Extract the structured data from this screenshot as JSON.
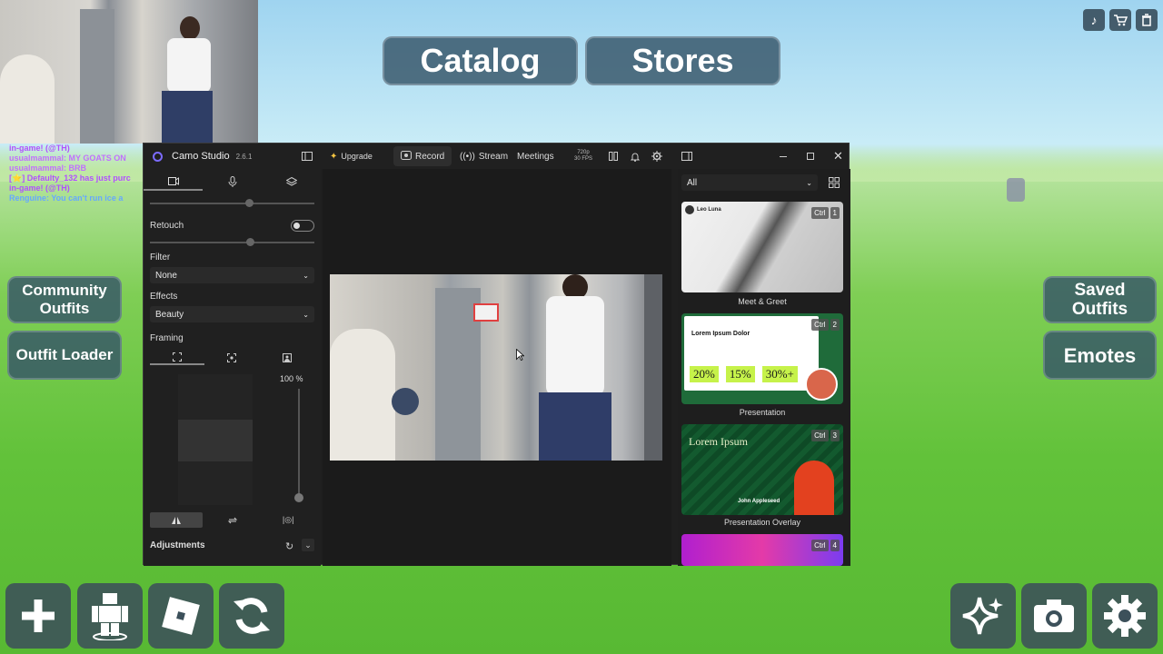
{
  "game": {
    "top_buttons": [
      "Catalog",
      "Stores"
    ],
    "left_buttons": [
      "Community Outfits",
      "Outfit Loader"
    ],
    "right_buttons": [
      "Saved Outfits",
      "Emotes"
    ],
    "bottom_left_icons": [
      "plus-icon",
      "avatar-icon",
      "roblox-logo-icon",
      "refresh-icon"
    ],
    "bottom_right_icons": [
      "sparkle-icon",
      "camera-icon",
      "settings-icon"
    ],
    "top_right_icons": [
      "music-icon",
      "cart-icon",
      "trash-icon"
    ]
  },
  "chat": {
    "lines": [
      {
        "text": "in-game! (@TH)",
        "color": "#b050ff"
      },
      {
        "text": "usualmammal: MY GOATS ON",
        "color": "#c070ff"
      },
      {
        "text": "usualmammal: BRB",
        "color": "#c070ff"
      },
      {
        "text": "[⭐] Defaulty_132 has just purc",
        "color": "#b050ff"
      },
      {
        "text": "in-game! (@TH)",
        "color": "#b050ff"
      },
      {
        "text": "Renguine: You can't run ice a",
        "color": "#66a8ff"
      }
    ]
  },
  "camo": {
    "app_name": "Camo Studio",
    "version": "2.6.1",
    "upgrade": "Upgrade",
    "record": "Record",
    "stream": "Stream",
    "meetings": "Meetings",
    "resolution": "720p",
    "fps": "30 FPS",
    "retouch_label": "Retouch",
    "filter_label": "Filter",
    "filter_value": "None",
    "effects_label": "Effects",
    "effects_value": "Beauty",
    "framing_label": "Framing",
    "zoom_value": "100 %",
    "adjustments_label": "Adjustments",
    "overlay_filter": "All",
    "overlays": [
      {
        "label": "Meet & Greet",
        "ctrl": "Ctrl",
        "key": "1",
        "card_name": "Leo Luna"
      },
      {
        "label": "Presentation",
        "ctrl": "Ctrl",
        "key": "2",
        "card_title": "Lorem Ipsum Dolor",
        "stats": [
          "20%",
          "15%",
          "30%+"
        ]
      },
      {
        "label": "Presentation Overlay",
        "ctrl": "Ctrl",
        "key": "3",
        "card_title": "Lorem Ipsum",
        "card_name": "John Appleseed"
      },
      {
        "label": "",
        "ctrl": "Ctrl",
        "key": "4"
      }
    ]
  }
}
